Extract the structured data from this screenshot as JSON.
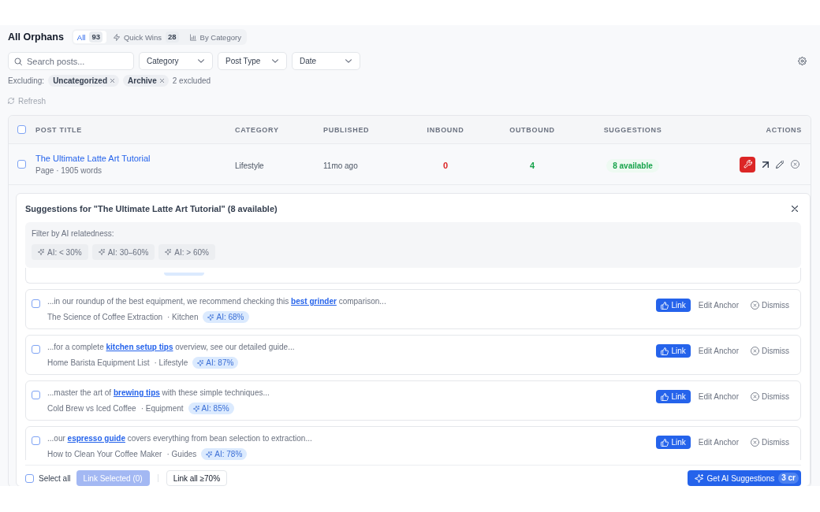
{
  "header": {
    "title": "All Orphans",
    "tabs": [
      {
        "label": "All",
        "count": "93",
        "kind": "plain",
        "selected": true
      },
      {
        "label": "Quick Wins",
        "count": "28",
        "kind": "quick",
        "selected": false
      },
      {
        "label": "By Category",
        "kind": "chart",
        "selected": false
      }
    ]
  },
  "filters": {
    "search": {
      "placeholder": "Search posts..."
    },
    "dropdowns": [
      {
        "label": "Category"
      },
      {
        "label": "Post Type"
      },
      {
        "label": "Date"
      }
    ]
  },
  "exclusions": {
    "label": "Excluding:",
    "chips": [
      {
        "label": "Uncategorized"
      },
      {
        "label": "Archive"
      }
    ],
    "summary": "2 excluded"
  },
  "refresh": {
    "label": "Refresh",
    "disabled": true
  },
  "table": {
    "header_checkbox": {
      "checked": false
    },
    "columns": [
      "POST TITLE",
      "CATEGORY",
      "PUBLISHED",
      "INBOUND",
      "OUTBOUND",
      "SUGGESTIONS",
      "ACTIONS"
    ],
    "rows": [
      {
        "title": "The Ultimate Latte Art Tutorial",
        "meta": "Page · 1905 words",
        "category": "Lifestyle",
        "published": "11mo ago",
        "inbound": "0",
        "outbound": "4",
        "suggestions": "8 available",
        "checked": false,
        "expanded": true,
        "details": {
          "title": "Suggestions for \"The Ultimate Latte Art Tutorial\" (8 available)",
          "filter_label": "Filter by AI relatedness:",
          "filter_chips": [
            {
              "label": "AI: < 30%",
              "selected": false
            },
            {
              "label": "AI: 30–60%",
              "selected": false
            },
            {
              "label": "AI: > 60%",
              "selected": false
            }
          ],
          "items": [
            {
              "snippet": "...in our roundup of the best equipment, we recommend checking this **best grinder** comparison...",
              "source": "The Science of Coffee Extraction",
              "category": "· Kitchen",
              "score": "AI: 68%",
              "checked": false,
              "link_label": "Link",
              "edit_label": "Edit Anchor",
              "dismiss_label": "Dismiss"
            },
            {
              "snippet": "...for a complete **kitchen setup tips** overview, see our detailed guide...",
              "source": "Home Barista Equipment List",
              "category": "· Lifestyle",
              "score": "AI: 87%",
              "checked": false,
              "link_label": "Link",
              "edit_label": "Edit Anchor",
              "dismiss_label": "Dismiss"
            },
            {
              "snippet": "...master the art of **brewing tips** with these simple techniques...",
              "source": "Cold Brew vs Iced Coffee",
              "category": "· Equipment",
              "score": "AI: 85%",
              "checked": false,
              "link_label": "Link",
              "edit_label": "Edit Anchor",
              "dismiss_label": "Dismiss"
            },
            {
              "snippet": "...our **espresso guide** covers everything from bean selection to extraction...",
              "source": "How to Clean Your Coffee Maker",
              "category": "· Guides",
              "score": "AI: 78%",
              "checked": false,
              "link_label": "Link",
              "edit_label": "Edit Anchor",
              "dismiss_label": "Dismiss"
            }
          ],
          "footer": {
            "select_all": {
              "label": "Select all",
              "checked": false
            },
            "link_selected": {
              "label": "Link Selected (0)",
              "disabled": true
            },
            "link_all": {
              "label": "Link all ≥70%"
            },
            "ai_button": {
              "label": "Get AI Suggestions",
              "credits": "3 cr"
            }
          }
        }
      }
    ]
  }
}
